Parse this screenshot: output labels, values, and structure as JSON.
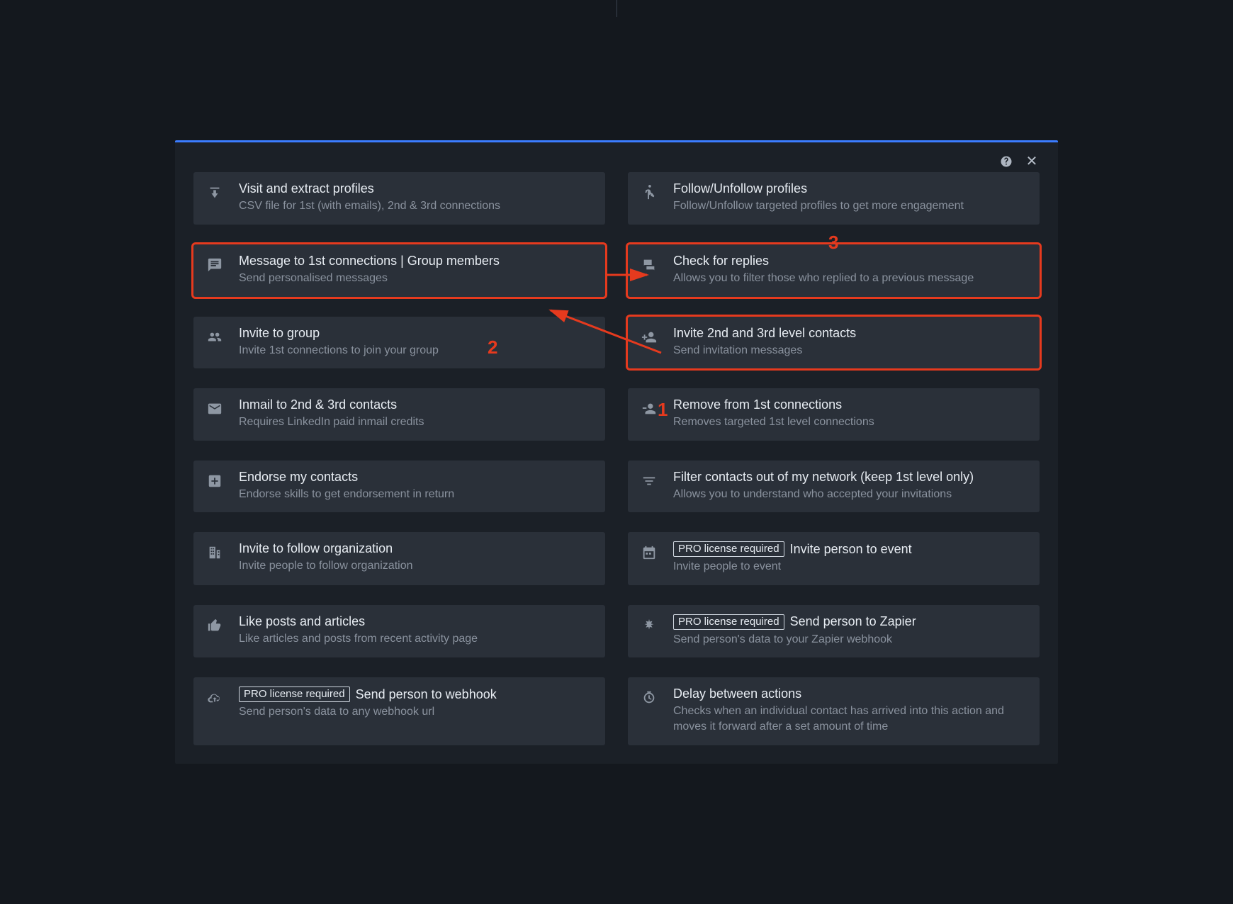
{
  "badge_text": "PRO license required",
  "annotations": {
    "one": "1",
    "two": "2",
    "three": "3"
  },
  "cards": {
    "visit": {
      "title": "Visit and extract profiles",
      "sub": "CSV file for 1st (with emails), 2nd & 3rd connections"
    },
    "follow": {
      "title": "Follow/Unfollow profiles",
      "sub": "Follow/Unfollow targeted profiles to get more engagement"
    },
    "message": {
      "title": "Message to 1st connections | Group members",
      "sub": "Send personalised messages"
    },
    "replies": {
      "title": "Check for replies",
      "sub": "Allows you to filter those who replied to a previous message"
    },
    "invite_group": {
      "title": "Invite to group",
      "sub": "Invite 1st connections to join your group"
    },
    "invite_23": {
      "title": "Invite 2nd and 3rd level contacts",
      "sub": "Send invitation messages"
    },
    "inmail": {
      "title": "Inmail to 2nd & 3rd contacts",
      "sub": "Requires LinkedIn paid inmail credits"
    },
    "remove": {
      "title": "Remove from 1st connections",
      "sub": "Removes targeted 1st level connections"
    },
    "endorse": {
      "title": "Endorse my contacts",
      "sub": "Endorse skills to get endorsement in return"
    },
    "filter": {
      "title": "Filter contacts out of my network (keep 1st level only)",
      "sub": "Allows you to understand who accepted your invitations"
    },
    "org": {
      "title": "Invite to follow organization",
      "sub": "Invite people to follow organization"
    },
    "event": {
      "title": "Invite person to event",
      "sub": "Invite people to event"
    },
    "like": {
      "title": "Like posts and articles",
      "sub": "Like articles and posts from recent activity page"
    },
    "zapier": {
      "title": "Send person to Zapier",
      "sub": "Send person's data to your Zapier webhook"
    },
    "webhook": {
      "title": "Send person to webhook",
      "sub": "Send person's data to any webhook url"
    },
    "delay": {
      "title": "Delay between actions",
      "sub": "Checks when an individual contact has arrived into this action and moves it forward after a set amount of time"
    }
  }
}
